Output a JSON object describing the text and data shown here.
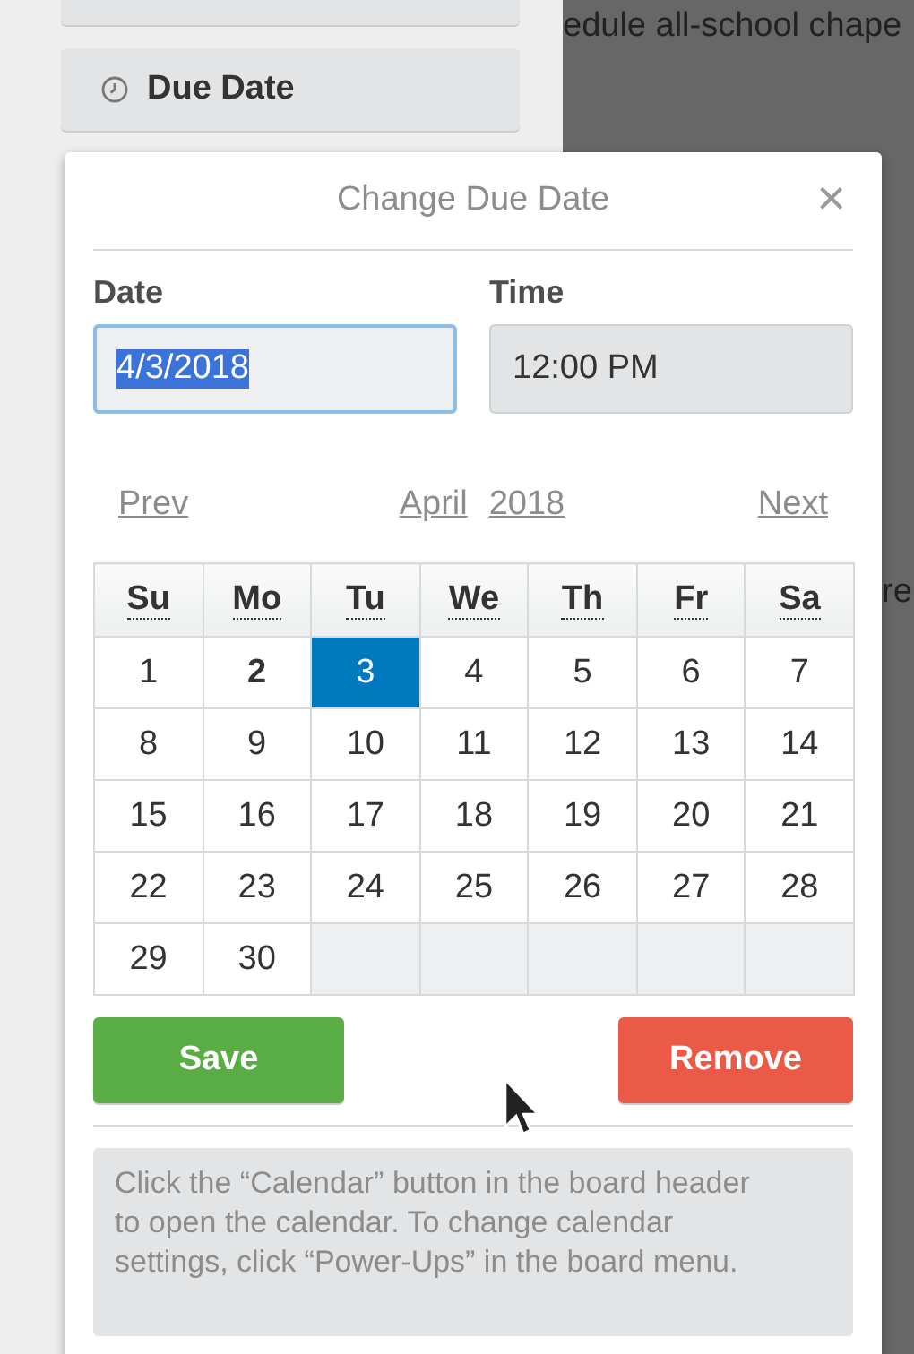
{
  "background": {
    "card_text": "edule all-school chape",
    "card_text_2": "re"
  },
  "sidebar": {
    "due_date_button": "Due Date"
  },
  "popover": {
    "title": "Change Due Date",
    "close": "×",
    "date": {
      "label": "Date",
      "value": "4/3/2018",
      "text_selected": true,
      "focused": true
    },
    "time": {
      "label": "Time",
      "value": "12:00 PM"
    },
    "nav": {
      "prev": "Prev",
      "month": "April",
      "year": "2018",
      "next": "Next"
    },
    "weekdays": [
      "Su",
      "Mo",
      "Tu",
      "We",
      "Th",
      "Fr",
      "Sa"
    ],
    "weeks": [
      [
        {
          "day": "1",
          "selected": false,
          "today": false
        },
        {
          "day": "2",
          "selected": false,
          "today": true
        },
        {
          "day": "3",
          "selected": true,
          "today": false
        },
        {
          "day": "4",
          "selected": false,
          "today": false
        },
        {
          "day": "5",
          "selected": false,
          "today": false
        },
        {
          "day": "6",
          "selected": false,
          "today": false
        },
        {
          "day": "7",
          "selected": false,
          "today": false
        }
      ],
      [
        {
          "day": "8",
          "selected": false,
          "today": false
        },
        {
          "day": "9",
          "selected": false,
          "today": false
        },
        {
          "day": "10",
          "selected": false,
          "today": false
        },
        {
          "day": "11",
          "selected": false,
          "today": false
        },
        {
          "day": "12",
          "selected": false,
          "today": false
        },
        {
          "day": "13",
          "selected": false,
          "today": false
        },
        {
          "day": "14",
          "selected": false,
          "today": false
        }
      ],
      [
        {
          "day": "15",
          "selected": false,
          "today": false
        },
        {
          "day": "16",
          "selected": false,
          "today": false
        },
        {
          "day": "17",
          "selected": false,
          "today": false
        },
        {
          "day": "18",
          "selected": false,
          "today": false
        },
        {
          "day": "19",
          "selected": false,
          "today": false
        },
        {
          "day": "20",
          "selected": false,
          "today": false
        },
        {
          "day": "21",
          "selected": false,
          "today": false
        }
      ],
      [
        {
          "day": "22",
          "selected": false,
          "today": false
        },
        {
          "day": "23",
          "selected": false,
          "today": false
        },
        {
          "day": "24",
          "selected": false,
          "today": false
        },
        {
          "day": "25",
          "selected": false,
          "today": false
        },
        {
          "day": "26",
          "selected": false,
          "today": false
        },
        {
          "day": "27",
          "selected": false,
          "today": false
        },
        {
          "day": "28",
          "selected": false,
          "today": false
        }
      ],
      [
        {
          "day": "29",
          "selected": false,
          "today": false
        },
        {
          "day": "30",
          "selected": false,
          "today": false
        }
      ]
    ],
    "save": "Save",
    "remove": "Remove",
    "info": "Click the “Calendar” button in the board header to open the calendar. To change calendar settings, click “Power-Ups” in the board menu."
  }
}
